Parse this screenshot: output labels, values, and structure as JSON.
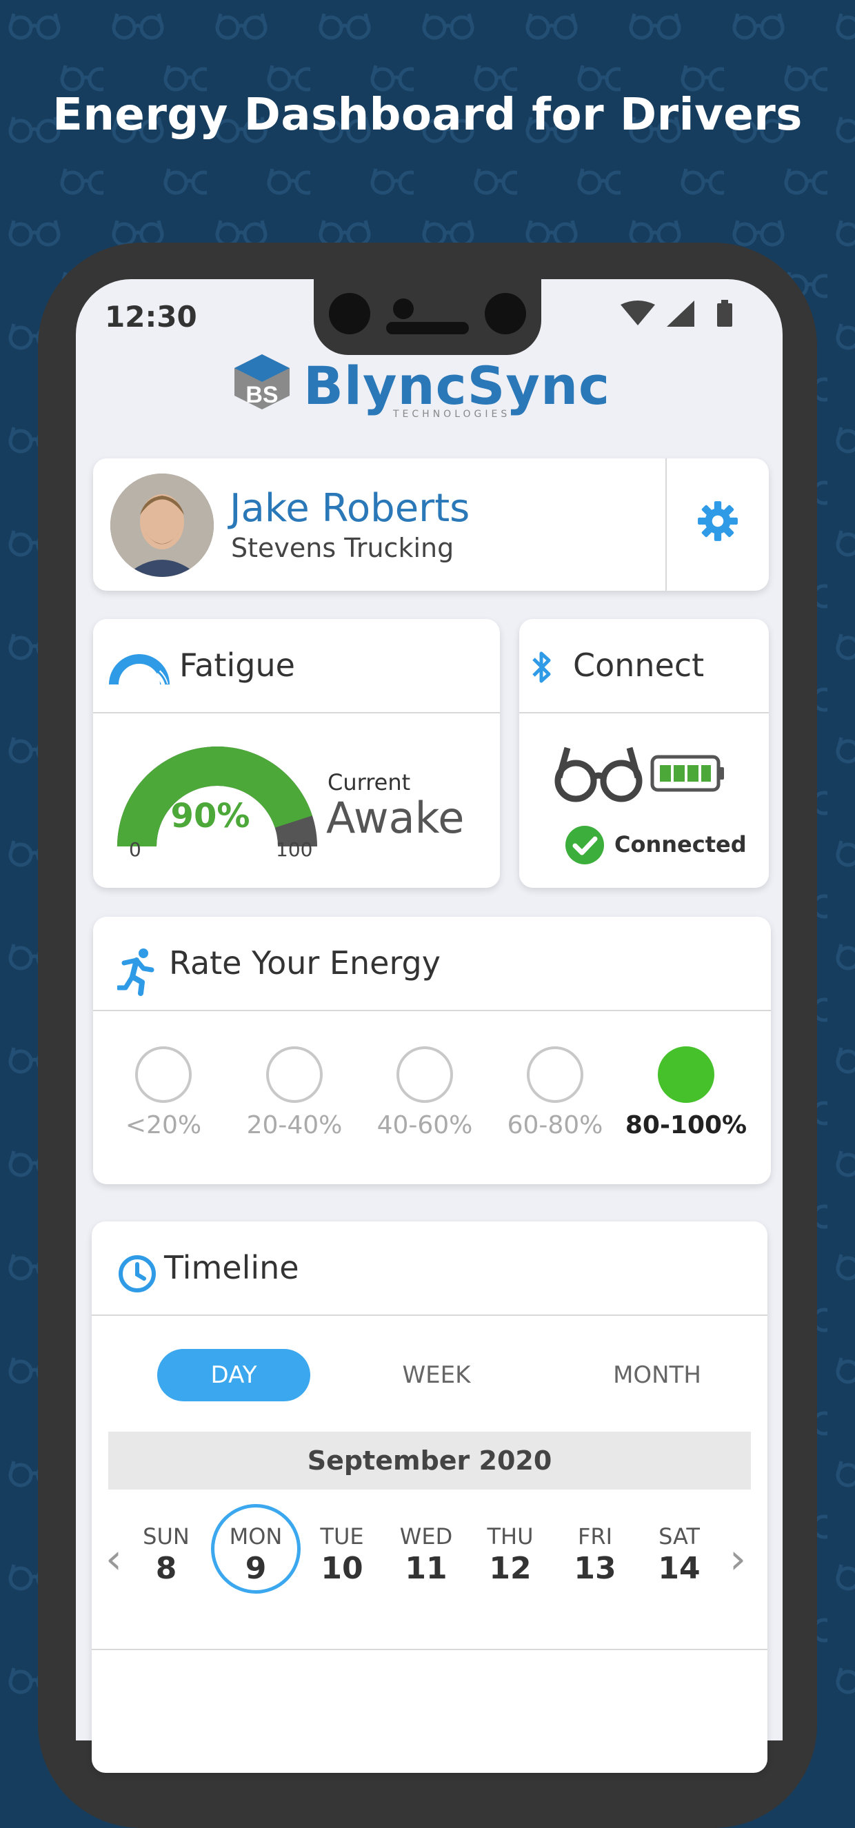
{
  "headline": "Energy Dashboard for Drivers",
  "status_bar": {
    "time": "12:30"
  },
  "logo": {
    "name": "BlyncSync",
    "subtitle": "TECHNOLOGIES"
  },
  "profile": {
    "name": "Jake Roberts",
    "company": "Stevens Trucking"
  },
  "fatigue": {
    "title": "Fatigue",
    "gauge_value": "90%",
    "gauge_percent": 90,
    "min_label": "0",
    "max_label": "100",
    "current_label": "Current",
    "current_state": "Awake"
  },
  "connect": {
    "title": "Connect",
    "status": "Connected"
  },
  "energy": {
    "title": "Rate Your Energy",
    "options": [
      "<20%",
      "20-40%",
      "40-60%",
      "60-80%",
      "80-100%"
    ],
    "selected": "80-100%"
  },
  "timeline": {
    "title": "Timeline",
    "tabs": [
      "DAY",
      "WEEK",
      "MONTH"
    ],
    "active_tab": "DAY",
    "month": "September 2020",
    "days": [
      {
        "name": "SUN",
        "date": "8"
      },
      {
        "name": "MON",
        "date": "9"
      },
      {
        "name": "TUE",
        "date": "10"
      },
      {
        "name": "WED",
        "date": "11"
      },
      {
        "name": "THU",
        "date": "12"
      },
      {
        "name": "FRI",
        "date": "13"
      },
      {
        "name": "SAT",
        "date": "14"
      }
    ],
    "selected_day": "MON"
  },
  "colors": {
    "background": "#163d5e",
    "brand_blue": "#2a78b8",
    "accent_blue": "#3aa7ee",
    "green": "#47c12b",
    "gauge_green": "#4da83a"
  }
}
